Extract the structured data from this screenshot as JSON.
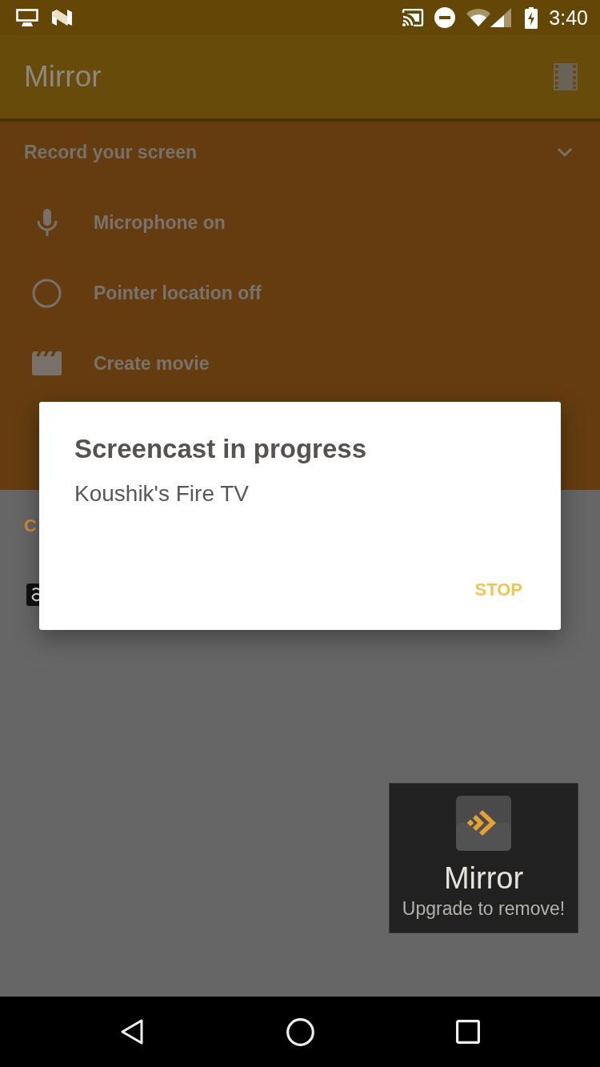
{
  "status_bar": {
    "time": "3:40"
  },
  "app_bar": {
    "title": "Mirror"
  },
  "record_section": {
    "title": "Record your screen",
    "items": [
      {
        "kind": "microphone",
        "label": "Microphone on"
      },
      {
        "kind": "pointer",
        "label": "Pointer location off"
      },
      {
        "kind": "movie",
        "label": "Create movie"
      }
    ]
  },
  "cast_section": {
    "title": "C"
  },
  "dialog": {
    "title": "Screencast in progress",
    "message": "Koushik's Fire TV",
    "buttons": [
      "STOP"
    ]
  },
  "promo": {
    "title": "Mirror",
    "subtitle": "Upgrade to remove!"
  }
}
